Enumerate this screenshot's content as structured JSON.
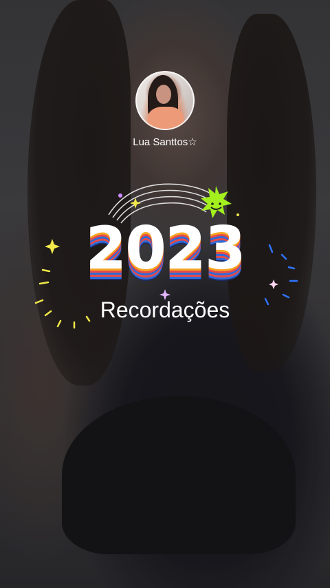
{
  "profile": {
    "username": "Lua Santtos☆",
    "avatar_icon": "profile-avatar"
  },
  "recap": {
    "year": "2023",
    "subtitle": "Recordações"
  },
  "colors": {
    "stripe_orange": "#f5a623",
    "stripe_red": "#e84a4a",
    "stripe_blue": "#2f6bd8",
    "sticker_green": "#a4f01f",
    "sparkle_yellow": "#f2e94b",
    "burst_blue": "#2f73ff"
  },
  "icons": [
    "smiley-sun-icon",
    "sparkle-icon",
    "rainbow-arc-icon",
    "firework-burst-icon"
  ]
}
